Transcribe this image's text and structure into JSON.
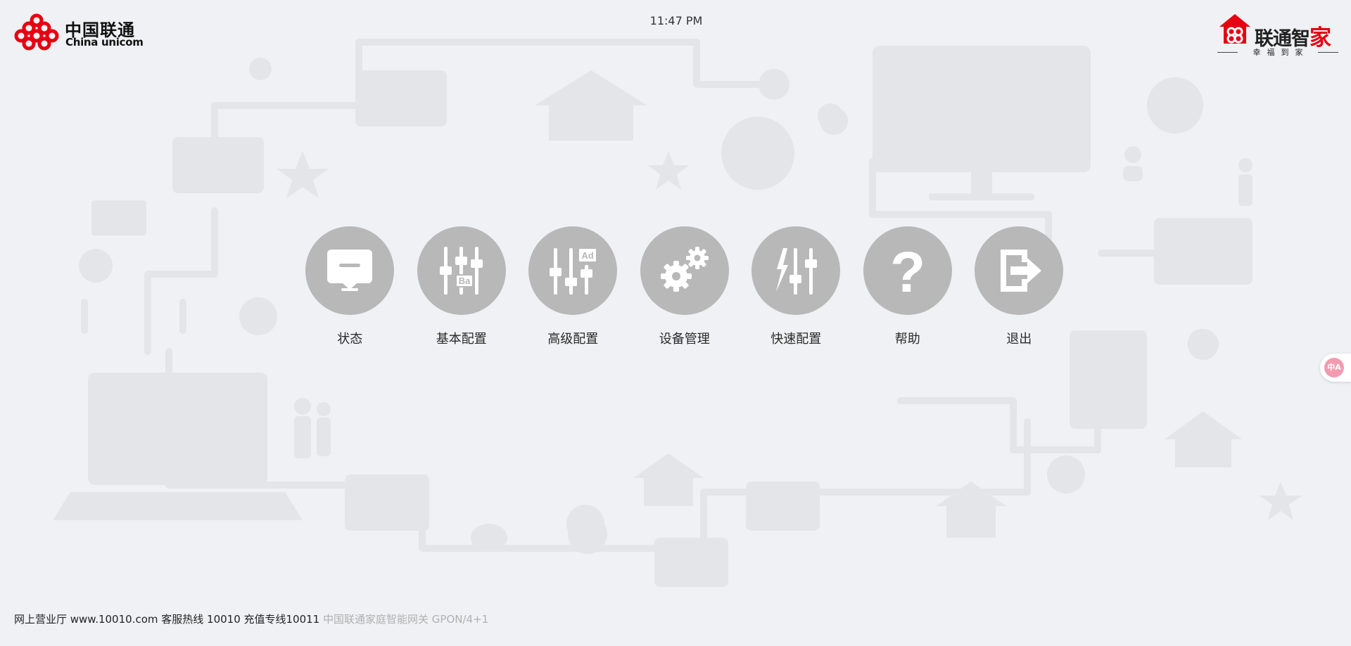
{
  "header": {
    "brand_cn": "中国联通",
    "brand_en": "China unicom",
    "clock": "11:47 PM",
    "wojia_name": "联通智",
    "wojia_name_accent": "家",
    "wojia_slogan": "幸福到家"
  },
  "menu": [
    {
      "label": "状态",
      "icon": "monitor-icon"
    },
    {
      "label": "基本配置",
      "icon": "sliders-ba-icon",
      "badge": "Ba"
    },
    {
      "label": "高级配置",
      "icon": "sliders-ad-icon",
      "badge": "Ad"
    },
    {
      "label": "设备管理",
      "icon": "gears-icon"
    },
    {
      "label": "快速配置",
      "icon": "sliders-lightning-icon"
    },
    {
      "label": "帮助",
      "icon": "question-icon",
      "glyph": "?"
    },
    {
      "label": "退出",
      "icon": "exit-icon"
    }
  ],
  "footer": {
    "contact": "网上营业厅 www.10010.com 客服热线 10010 充值专线10011",
    "model": "中国联通家庭智能网关 GPON/4+1"
  },
  "side_widget": {
    "glyph": "中A"
  },
  "colors": {
    "background": "#f0f1f4",
    "icon_circle": "#b8b8b8",
    "brand_red": "#e60012",
    "footer_model": "#b0b0b0"
  }
}
